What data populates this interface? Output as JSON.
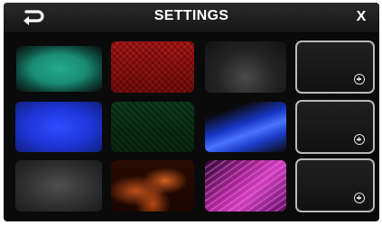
{
  "header": {
    "title": "SETTINGS",
    "back_icon": "back-arrow-icon",
    "close_label": "X"
  },
  "grid": {
    "rows": [
      {
        "tiles": [
          {
            "name": "green",
            "color": "#1a8d73"
          },
          {
            "name": "red-pattern",
            "color": "#a31515"
          },
          {
            "name": "dark-gray",
            "color": "#2a2a2a"
          }
        ],
        "slot_icon": "add-circle-icon"
      },
      {
        "tiles": [
          {
            "name": "blue",
            "color": "#1e34d6"
          },
          {
            "name": "dark-green-pattern",
            "color": "#0f3b1b"
          },
          {
            "name": "blue-streak",
            "color": "#2c4dff"
          }
        ],
        "slot_icon": "add-circle-icon"
      },
      {
        "tiles": [
          {
            "name": "gray",
            "color": "#3a3a3a"
          },
          {
            "name": "fire",
            "color": "#c0501a"
          },
          {
            "name": "purple-swirl",
            "color": "#c03aa8"
          }
        ],
        "slot_icon": "add-circle-icon"
      }
    ]
  }
}
